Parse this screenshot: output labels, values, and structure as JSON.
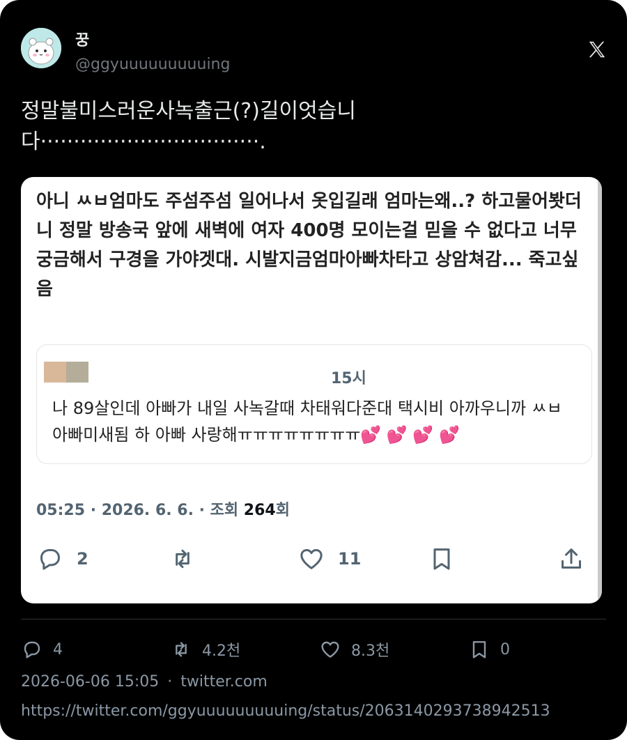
{
  "author": {
    "name": "꿍",
    "handle": "@ggyuuuuuuuuuing",
    "avatar_icon": "hamster-avatar-icon"
  },
  "brand_icon": "x-logo-icon",
  "tweet": {
    "text": "정말불미스러운사녹출근(?)길이엇습니\n다·································."
  },
  "screenshot": {
    "text": "아니 ㅆㅂ엄마도 주섬주섬 일어나서 옷입길래 엄마는왜..? 하고물어봣더니 정말 방송국 앞에 새벽에 여자 400명 모이는걸 믿을 수 없다고 너무 궁금해서 구경을 가야겟대. 시발지금엄마아빠차타고 상암쳐감... 죽고싶음",
    "quote": {
      "time": "15시",
      "text": "나 89살인데 아빠가 내일 사녹갈때 차태워다준대 택시비 아까우니까 ㅆㅂ 아빠미새됨 하 아빠 사랑해ㅠㅠㅠㅠㅠㅠㅠㅠ💕 💕 💕 💕"
    },
    "meta": {
      "time_date": "05:25 · 2026. 6. 6. · ",
      "views_label": "조회 ",
      "views_count": "264",
      "views_suffix": "회"
    },
    "actions": {
      "replies": "2",
      "likes": "11"
    }
  },
  "actions": {
    "replies": "4",
    "retweets": "4.2천",
    "likes": "8.3천",
    "bookmarks": "0"
  },
  "footer": {
    "timestamp": "2026-06-06 15:05",
    "separator": "·",
    "source": "twitter.com",
    "url": "https://twitter.com/ggyuuuuuuuuuing/status/2063140293738942513"
  },
  "colors": {
    "background": "#000000",
    "text": "#e7e9ea",
    "muted": "#71767b",
    "heart_pink": "#e0449a"
  }
}
